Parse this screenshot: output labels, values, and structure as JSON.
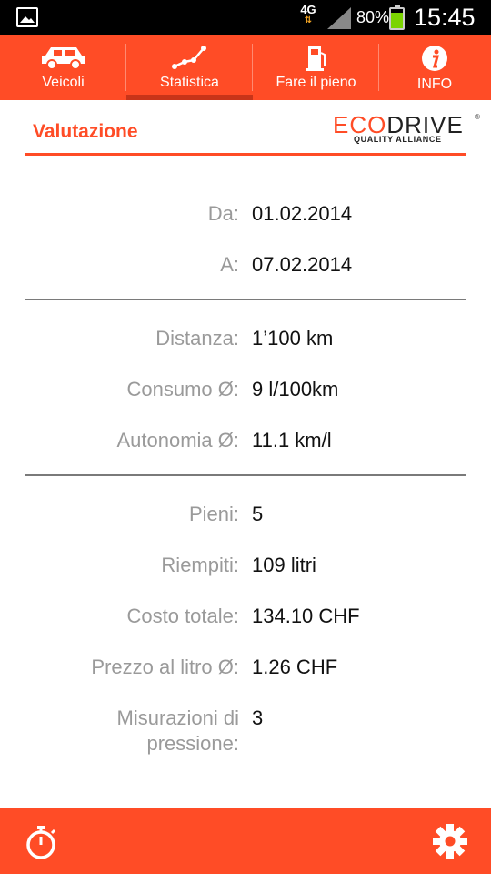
{
  "status_bar": {
    "network": "4G",
    "battery_percent": "80%",
    "battery_level": 0.8,
    "time": "15:45"
  },
  "tabs": [
    {
      "label": "Veicoli",
      "icon": "car-icon"
    },
    {
      "label": "Statistica",
      "icon": "chart-line-icon",
      "active": true
    },
    {
      "label": "Fare il pieno",
      "icon": "fuel-pump-icon"
    },
    {
      "label": "INFO",
      "icon": "info-icon"
    }
  ],
  "header": {
    "title": "Valutazione",
    "logo_eco": "ECO",
    "logo_drive": "DRIVE",
    "logo_reg": "®",
    "logo_tagline": "QUALITY ALLIANCE"
  },
  "period": {
    "from_label": "Da:",
    "from_value": "01.02.2014",
    "to_label": "A:",
    "to_value": "07.02.2014"
  },
  "consumption": {
    "distance_label": "Distanza:",
    "distance_value": "1’100 km",
    "avg_consumption_label": "Consumo Ø:",
    "avg_consumption_value": "9 l/100km",
    "avg_range_label": "Autonomia Ø:",
    "avg_range_value": "11.1 km/l"
  },
  "refuel": {
    "fillups_label": "Pieni:",
    "fillups_value": "5",
    "filled_label": "Riempiti:",
    "filled_value": "109 litri",
    "total_cost_label": "Costo totale:",
    "total_cost_value": "134.10 CHF",
    "avg_price_label": "Prezzo al litro Ø:",
    "avg_price_value": "1.26 CHF",
    "pressure_label_line1": "Misurazioni di",
    "pressure_label_line2": "pressione:",
    "pressure_value": "3"
  },
  "colors": {
    "accent": "#ff4c26",
    "active_tab_underline": "#c83419",
    "label_gray": "#9a9a9a"
  }
}
